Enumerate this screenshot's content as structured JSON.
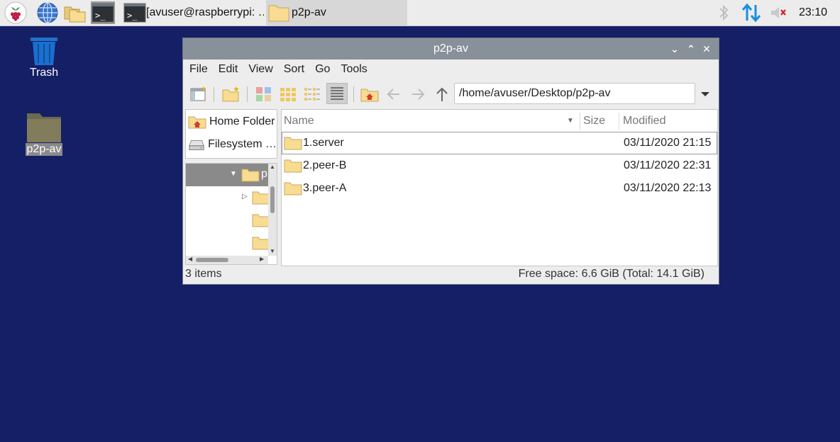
{
  "taskbar": {
    "tasks": [
      {
        "label": "[avuser@raspberrypi: …"
      },
      {
        "label": "p2p-av"
      }
    ],
    "clock": "23:10",
    "launcher_icons": [
      "raspberry-menu-icon",
      "browser-globe-icon",
      "file-manager-icon",
      "terminal-icon"
    ],
    "tray_icons": [
      "bluetooth-icon",
      "network-updown-icon",
      "volume-muted-icon"
    ]
  },
  "desktop": {
    "icons": [
      {
        "label": "Trash"
      },
      {
        "label": "p2p-av"
      }
    ],
    "background_color": "#141f66"
  },
  "window": {
    "title": "p2p-av",
    "controls": [
      "minimize",
      "maximize",
      "close"
    ],
    "menu": [
      "File",
      "Edit",
      "View",
      "Sort",
      "Go",
      "Tools"
    ],
    "path": "/home/avuser/Desktop/p2p-av",
    "places": [
      {
        "label": "Home Folder"
      },
      {
        "label": "Filesystem …"
      }
    ],
    "tree_label": "p",
    "columns": {
      "name": "Name",
      "size": "Size",
      "modified": "Modified"
    },
    "files": [
      {
        "name": "1.server",
        "modified": "03/11/2020 21:15"
      },
      {
        "name": "2.peer-B",
        "modified": "03/11/2020 22:31"
      },
      {
        "name": "3.peer-A",
        "modified": "03/11/2020 22:13"
      }
    ],
    "status": {
      "items": "3 items",
      "free_space": "Free space: 6.6 GiB (Total: 14.1 GiB)"
    }
  }
}
